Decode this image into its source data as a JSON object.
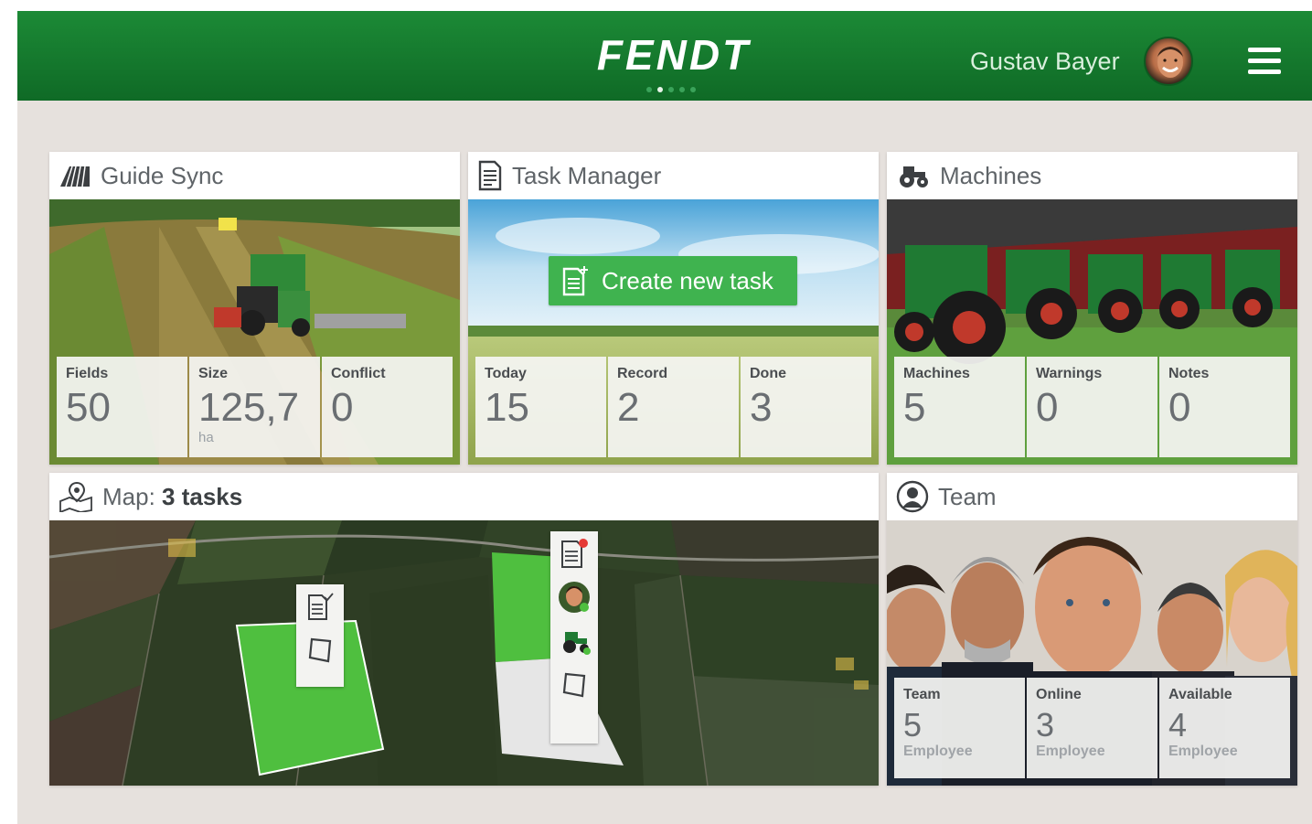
{
  "header": {
    "brand": "FENDT",
    "user_name": "Gustav Bayer",
    "page_dots": 5,
    "active_dot": 1,
    "brand_color": "#138231"
  },
  "cards": {
    "guide_sync": {
      "title": "Guide Sync",
      "icon": "field-rows-icon",
      "stats": [
        {
          "label": "Fields",
          "value": "50",
          "unit": ""
        },
        {
          "label": "Size",
          "value": "125,7",
          "unit": "ha"
        },
        {
          "label": "Conflict",
          "value": "0",
          "unit": ""
        }
      ]
    },
    "task_manager": {
      "title": "Task Manager",
      "icon": "document-icon",
      "create_button": "Create new task",
      "stats": [
        {
          "label": "Today",
          "value": "15"
        },
        {
          "label": "Record",
          "value": "2"
        },
        {
          "label": "Done",
          "value": "3"
        }
      ]
    },
    "machines": {
      "title": "Machines",
      "icon": "tractor-icon",
      "stats": [
        {
          "label": "Machines",
          "value": "5"
        },
        {
          "label": "Warnings",
          "value": "0"
        },
        {
          "label": "Notes",
          "value": "0"
        }
      ]
    },
    "map": {
      "title_prefix": "Map:",
      "title_bold": "3 tasks",
      "icon": "map-pin-icon"
    },
    "team": {
      "title": "Team",
      "icon": "person-circle-icon",
      "stats": [
        {
          "label": "Team",
          "value": "5",
          "unit": "Employee"
        },
        {
          "label": "Online",
          "value": "3",
          "unit": "Employee"
        },
        {
          "label": "Available",
          "value": "4",
          "unit": "Employee"
        }
      ]
    }
  },
  "colors": {
    "accent_green": "#3fb34f",
    "field_green": "#4fbf3f",
    "alert_red": "#e53935"
  }
}
